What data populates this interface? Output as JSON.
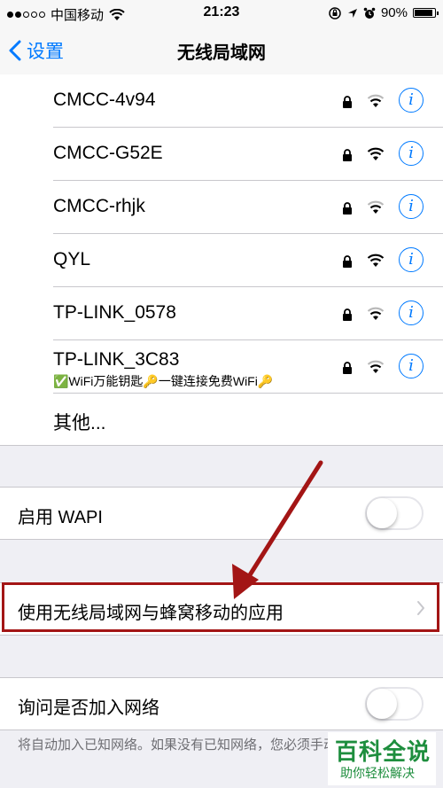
{
  "status_bar": {
    "carrier": "中国移动",
    "time": "21:23",
    "battery": "90%",
    "battery_level": 0.9
  },
  "nav": {
    "back_label": "设置",
    "title": "无线局域网"
  },
  "networks": [
    {
      "name": "CMCC-4v94",
      "signal": 2,
      "locked": true
    },
    {
      "name": "CMCC-G52E",
      "signal": 3,
      "locked": true
    },
    {
      "name": "CMCC-rhjk",
      "signal": 2,
      "locked": true
    },
    {
      "name": "QYL",
      "signal": 3,
      "locked": true
    },
    {
      "name": "TP-LINK_0578",
      "signal": 2,
      "locked": true
    },
    {
      "name": "TP-LINK_3C83",
      "subtitle": "✅WiFi万能钥匙🔑一键连接免费WiFi🔑",
      "signal": 2,
      "locked": true
    }
  ],
  "other_label": "其他...",
  "wapi": {
    "label": "启用 WAPI",
    "enabled": false
  },
  "apps_row": {
    "label": "使用无线局域网与蜂窝移动的应用"
  },
  "ask_join": {
    "label": "询问是否加入网络",
    "enabled": false
  },
  "footer_text": "将自动加入已知网络。如果没有已知网络，您必须手动选择。",
  "watermark": {
    "title": "百科全说",
    "subtitle": "助你轻松解决"
  },
  "colors": {
    "accent": "#007aff",
    "highlight": "#a31515",
    "watermark": "#1e8e3e"
  }
}
